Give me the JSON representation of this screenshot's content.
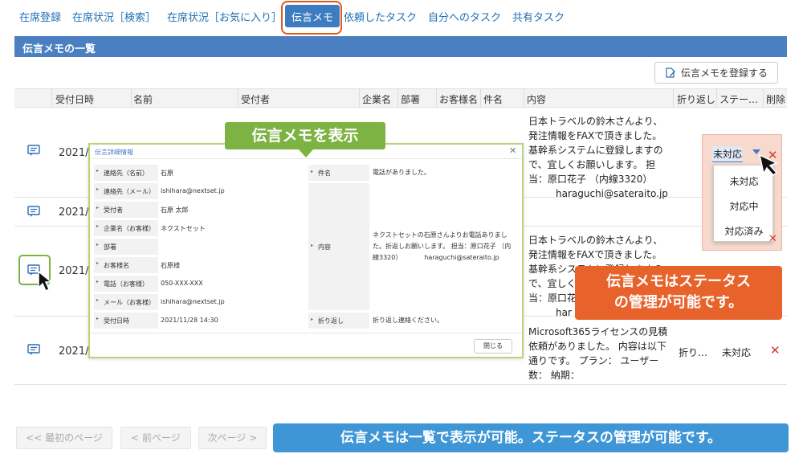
{
  "tabs": [
    {
      "label": "在席登録"
    },
    {
      "label": "在席状況［検索］"
    },
    {
      "label": "在席状況［お気に入り］"
    },
    {
      "label": "伝言メモ"
    },
    {
      "label": "依頼したタスク"
    },
    {
      "label": "自分へのタスク"
    },
    {
      "label": "共有タスク"
    }
  ],
  "section": {
    "title": "伝言メモの一覧"
  },
  "toolbar": {
    "register_label": "伝言メモを登録する"
  },
  "table": {
    "columns": [
      "受付日時",
      "名前",
      "受付者",
      "企業名",
      "部署",
      "お客様名",
      "件名",
      "内容",
      "折り返し",
      "ステー…",
      "削除"
    ],
    "rows": [
      {
        "date": "2021/0",
        "content": "日本トラベルの鈴木さんより、発注情報をFAXで頂きました。基幹系システムに登録しますので、宜しくお願いします。 担当：原口花子 （内線3320）",
        "mail": "haraguchi@sateraito.jp",
        "status": "未対応"
      },
      {
        "date": "2021/0"
      },
      {
        "date": "2021/1",
        "content": "日本トラベルの鈴木さんより、発注情報をFAXで頂きました。基幹系システムに登録しますので、宜しくお願いします。 担当：原口花子 （内線3320）",
        "mail": "har"
      },
      {
        "date": "2021/1",
        "content": "Microsoft365ライセンスの見積依頼がありました。 内容は以下通りです。 プラン： ユーザー数： 納期：",
        "callback": "折り…",
        "status": "未対応"
      }
    ]
  },
  "status_dropdown": {
    "selected": "未対応",
    "options": [
      "未対応",
      "対応中",
      "対応済み"
    ]
  },
  "modal": {
    "title": "伝言詳細情報",
    "fields": [
      {
        "label": "連絡先（名前）",
        "value": "石原"
      },
      {
        "label": "連絡先（メール）",
        "value": "ishihara@nextset.jp"
      },
      {
        "label": "受付者",
        "value": "石原 太郎"
      },
      {
        "label": "企業名（お客様）",
        "value": "ネクストセット"
      },
      {
        "label": "部署",
        "value": ""
      },
      {
        "label": "お客様名",
        "value": "石原様"
      },
      {
        "label": "電話（お客様）",
        "value": "050-XXX-XXX"
      },
      {
        "label": "メール（お客様）",
        "value": "ishihara@nextset.jp"
      },
      {
        "label": "受付日時",
        "value": "2021/11/28 14:30"
      }
    ],
    "subject_label": "件名",
    "subject_value": "電話がありました。",
    "content_label": "内容",
    "content_value": "ネクストセットの石原さんよりお電話ありました。折返しお願いします。 担当：原口花子 （内線3320）　　　　haraguchi@sateraito.jp",
    "callback_label": "折り返し",
    "callback_value": "折り返し連絡ください。",
    "close_label": "閉じる"
  },
  "callouts": {
    "show_memo": "伝言メモを表示",
    "status_line1": "伝言メモはステータス",
    "status_line2": "の管理が可能です。",
    "bottom": "伝言メモは一覧で表示が可能。ステータスの管理が可能です。"
  },
  "pager": {
    "first": "<< 最初のページ",
    "prev": "< 前ページ",
    "next": "次ページ >"
  },
  "icons": {
    "memo": "message-icon",
    "register": "edit-doc-icon",
    "delete": "close-icon"
  },
  "colors": {
    "accent": "#3d7cc0",
    "highlight_orange": "#e8632c",
    "highlight_green": "#7cb342",
    "delete": "#d63a2a"
  }
}
